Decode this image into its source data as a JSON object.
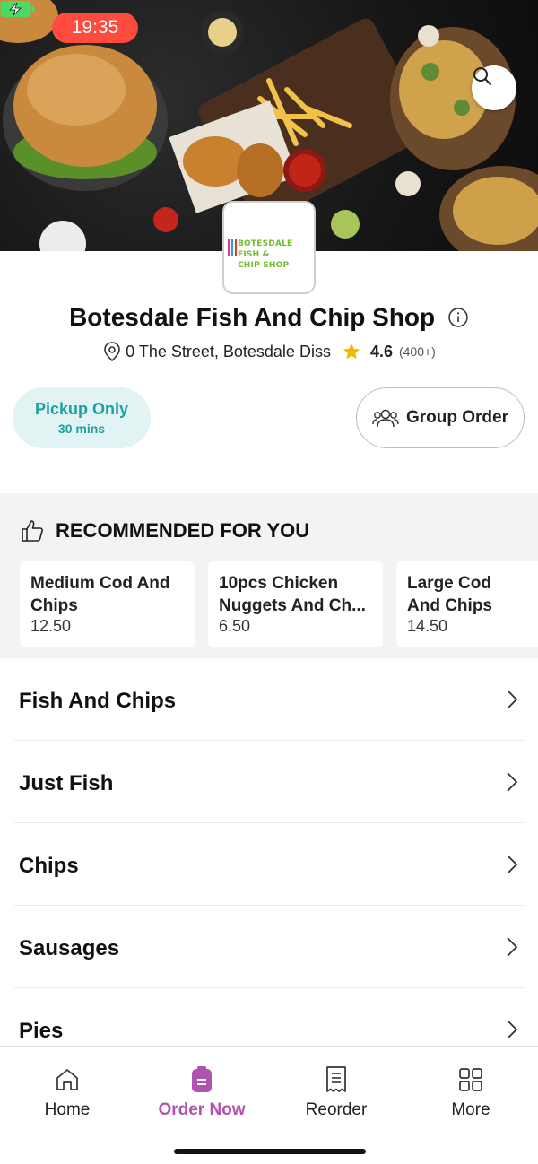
{
  "status_bar": {
    "time": "19:35"
  },
  "logo": {
    "line1": "BOTESDALE FISH &",
    "line2": "CHIP SHOP"
  },
  "shop": {
    "name": "Botesdale Fish And Chip Shop",
    "address": "0 The Street, Botesdale Diss",
    "rating": "4.6",
    "rating_count": "(400+)"
  },
  "order_mode": {
    "label": "Pickup Only",
    "time": "30 mins"
  },
  "group_order": {
    "label": "Group Order"
  },
  "recommended": {
    "heading": "RECOMMENDED FOR YOU",
    "items": [
      {
        "name": "Medium Cod And Chips",
        "price": "12.50"
      },
      {
        "name": "10pcs Chicken Nuggets And Ch...",
        "price": "6.50"
      },
      {
        "name": "Large Cod And Chips",
        "price": "14.50"
      }
    ]
  },
  "categories": [
    "Fish And Chips",
    "Just Fish",
    "Chips",
    "Sausages",
    "Pies"
  ],
  "bottom_nav": [
    {
      "label": "Home",
      "icon": "home-icon"
    },
    {
      "label": "Order Now",
      "icon": "order-icon"
    },
    {
      "label": "Reorder",
      "icon": "receipt-icon"
    },
    {
      "label": "More",
      "icon": "grid-icon"
    }
  ],
  "colors": {
    "accent": "#b152b0",
    "teal": "#1aa1a0",
    "pickup_bg": "#e1f3f3",
    "time_pill": "#ff4b3e"
  }
}
